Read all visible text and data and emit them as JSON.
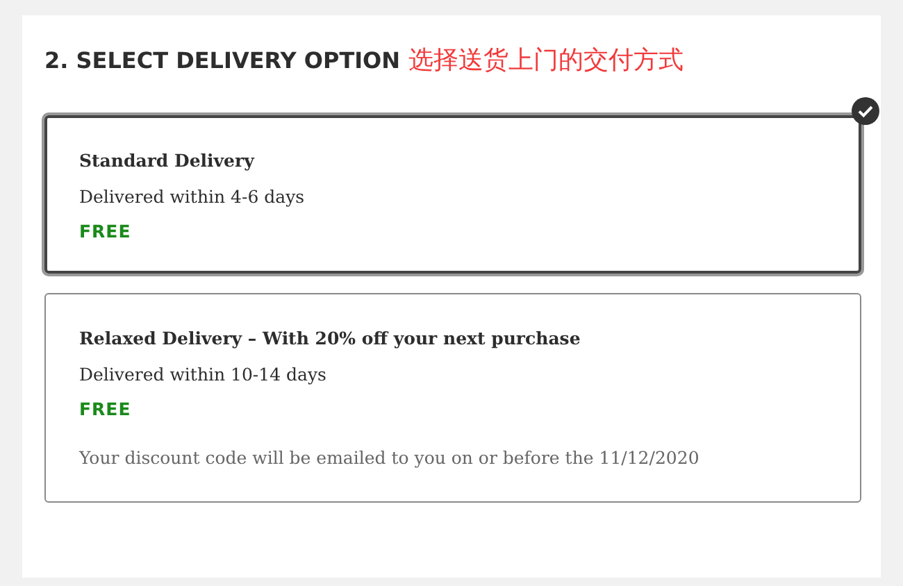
{
  "heading": {
    "title": "2. SELECT DELIVERY OPTION",
    "annotation": "选择送货上门的交付方式"
  },
  "options": [
    {
      "name": "Standard Delivery",
      "eta": "Delivered within 4-6 days",
      "price": "FREE",
      "selected": true
    },
    {
      "name": "Relaxed Delivery – With 20% off your next purchase",
      "eta": "Delivered within 10-14 days",
      "price": "FREE",
      "note": "Your discount code will be emailed to you on or before the 11/12/2020",
      "selected": false
    }
  ]
}
